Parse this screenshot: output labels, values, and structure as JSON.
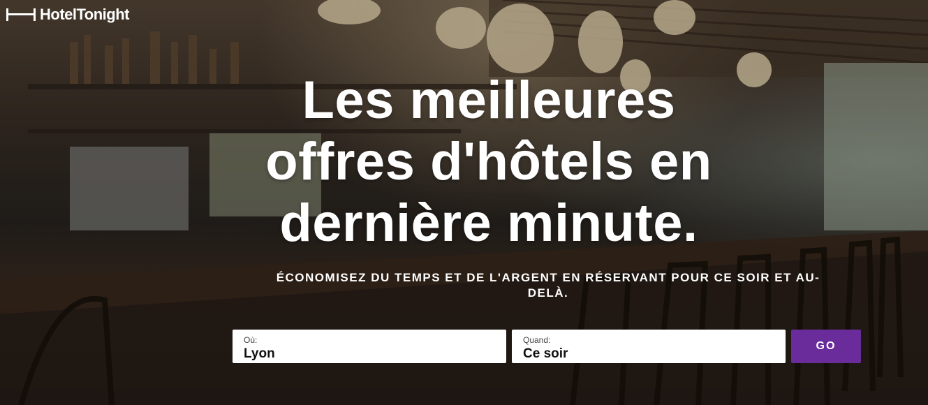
{
  "brand": {
    "name": "HotelTonight",
    "logo_icon": "bed-icon"
  },
  "hero": {
    "headline": "Les meilleures offres d'hôtels en dernière minute.",
    "subline": "ÉCONOMISEZ DU TEMPS ET DE L'ARGENT EN RÉSERVANT POUR CE SOIR ET AU-DELÀ."
  },
  "search": {
    "where_label": "Où:",
    "where_value": "Lyon",
    "when_label": "Quand:",
    "when_value": "Ce soir",
    "go_label": "GO"
  },
  "colors": {
    "accent": "#6a2c9a",
    "text": "#ffffff"
  }
}
